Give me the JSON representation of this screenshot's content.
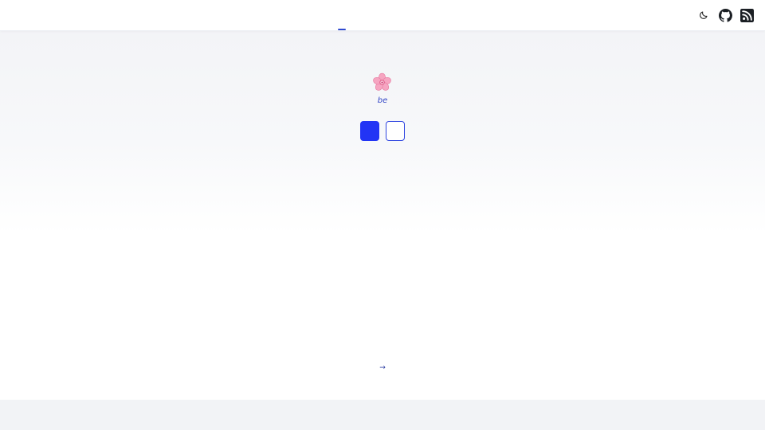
{
  "header": {
    "icons": {
      "theme": "moon-icon",
      "github": "github-icon",
      "rss": "rss-icon"
    },
    "accent_color": "#2f4ad0"
  },
  "hero": {
    "emoji": "🌸",
    "tagline": "be",
    "buttons": [
      {
        "style": "filled",
        "color": "#2234f5"
      },
      {
        "style": "outline",
        "color": "#2f45e0"
      }
    ]
  },
  "bottom": {
    "arrow": "→"
  }
}
